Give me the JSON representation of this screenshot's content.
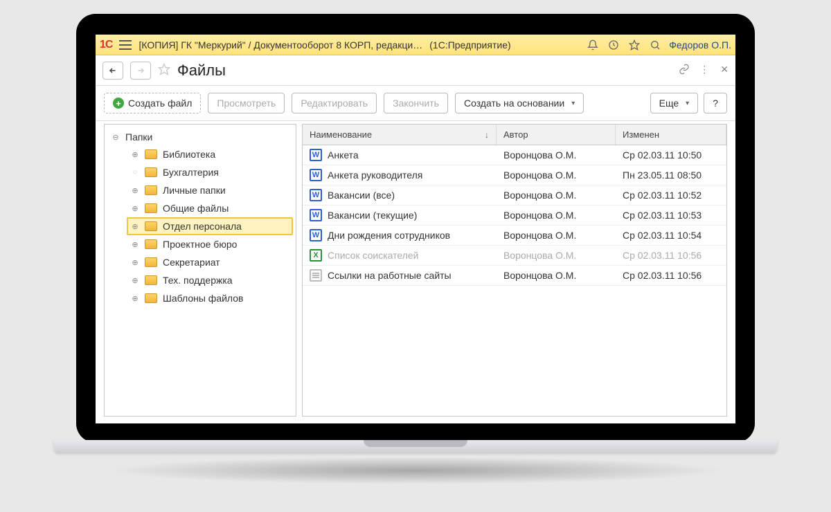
{
  "topbar": {
    "app_title": "[КОПИЯ] ГК \"Меркурий\" / Документооборот 8 КОРП, редакци…",
    "app_suffix": "(1С:Предприятие)",
    "username": "Федоров О.П."
  },
  "header": {
    "title": "Файлы"
  },
  "toolbar": {
    "create_file": "Создать файл",
    "view": "Просмотреть",
    "edit": "Редактировать",
    "finish": "Закончить",
    "create_from": "Создать на основании",
    "more": "Еще",
    "help": "?"
  },
  "sidebar": {
    "root_label": "Папки",
    "folders": [
      {
        "label": "Библиотека",
        "selected": false
      },
      {
        "label": "Бухгалтерия",
        "selected": false,
        "empty": true
      },
      {
        "label": "Личные папки",
        "selected": false
      },
      {
        "label": "Общие файлы",
        "selected": false
      },
      {
        "label": "Отдел персонала",
        "selected": true
      },
      {
        "label": "Проектное бюро",
        "selected": false
      },
      {
        "label": "Секретариат",
        "selected": false
      },
      {
        "label": "Тех. поддержка",
        "selected": false
      },
      {
        "label": "Шаблоны файлов",
        "selected": false
      }
    ]
  },
  "grid": {
    "columns": {
      "name": "Наименование",
      "author": "Автор",
      "changed": "Изменен"
    },
    "rows": [
      {
        "icon": "word",
        "name": "Анкета",
        "author": "Воронцова О.М.",
        "changed": "Ср 02.03.11 10:50"
      },
      {
        "icon": "word",
        "name": "Анкета руководителя",
        "author": "Воронцова О.М.",
        "changed": "Пн 23.05.11 08:50"
      },
      {
        "icon": "word",
        "name": "Вакансии (все)",
        "author": "Воронцова О.М.",
        "changed": "Ср 02.03.11 10:52"
      },
      {
        "icon": "word",
        "name": "Вакансии (текущие)",
        "author": "Воронцова О.М.",
        "changed": "Ср 02.03.11 10:53"
      },
      {
        "icon": "word",
        "name": "Дни рождения сотрудников",
        "author": "Воронцова О.М.",
        "changed": "Ср 02.03.11 10:54"
      },
      {
        "icon": "excel",
        "name": "Список соискателей",
        "author": "Воронцова О.М.",
        "changed": "Ср 02.03.11 10:56",
        "disabled": true
      },
      {
        "icon": "text",
        "name": "Ссылки на работные сайты",
        "author": "Воронцова О.М.",
        "changed": "Ср 02.03.11 10:56"
      }
    ]
  }
}
